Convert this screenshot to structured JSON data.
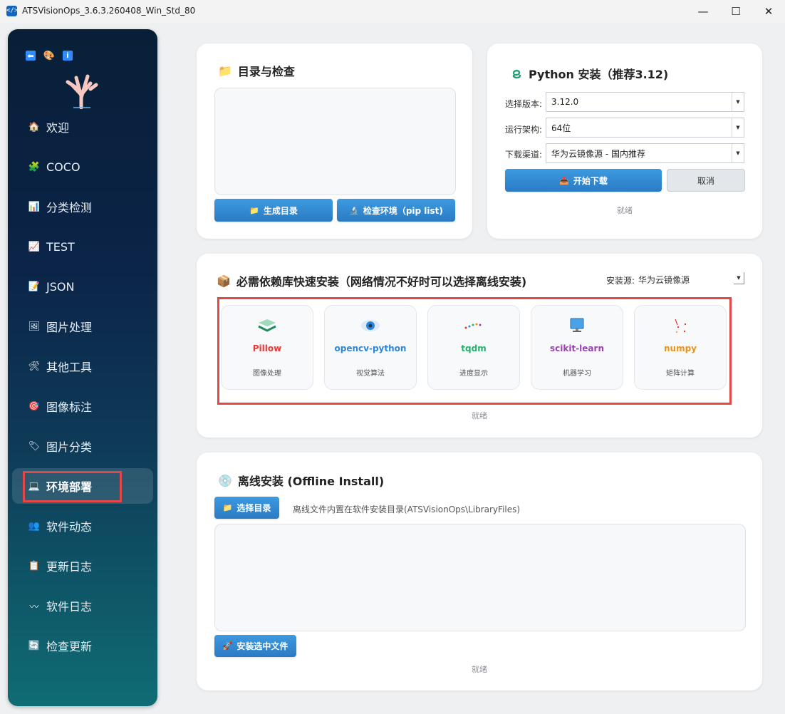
{
  "window": {
    "title": "ATSVisionOps_3.6.3.260408_Win_Std_80",
    "app_icon": "</>",
    "controls": {
      "minimize": "—",
      "maximize": "☐",
      "close": "✕"
    }
  },
  "sidebar": {
    "top_icons": [
      "back-icon",
      "palette-icon",
      "info-icon"
    ],
    "items": [
      {
        "label": "欢迎",
        "icon": "🏠",
        "icon_name": "home-icon"
      },
      {
        "label": "COCO",
        "icon": "🧩",
        "icon_name": "puzzle-icon"
      },
      {
        "label": "分类检测",
        "icon": "📊",
        "icon_name": "bar-chart-icon"
      },
      {
        "label": "TEST",
        "icon": "📈",
        "icon_name": "line-chart-icon"
      },
      {
        "label": "JSON",
        "icon": "📝",
        "icon_name": "memo-icon"
      },
      {
        "label": "图片处理",
        "icon": "🖼",
        "icon_name": "picture-icon"
      },
      {
        "label": "其他工具",
        "icon": "🛠",
        "icon_name": "tools-icon"
      },
      {
        "label": "图像标注",
        "icon": "🎯",
        "icon_name": "target-icon"
      },
      {
        "label": "图片分类",
        "icon": "🏷",
        "icon_name": "tag-icon"
      },
      {
        "label": "环境部署",
        "icon": "💻",
        "icon_name": "laptop-icon",
        "active": true
      },
      {
        "label": "软件动态",
        "icon": "👥",
        "icon_name": "people-icon"
      },
      {
        "label": "更新日志",
        "icon": "📋",
        "icon_name": "clipboard-icon"
      },
      {
        "label": "软件日志",
        "icon": "〰",
        "icon_name": "worm-icon"
      },
      {
        "label": "检查更新",
        "icon": "🔄",
        "icon_name": "refresh-icon"
      }
    ]
  },
  "directory_panel": {
    "title": "目录与检查",
    "title_icon": "📁",
    "generate_button": "生成目录",
    "check_button": "检查环境（pip list)"
  },
  "python_panel": {
    "title": "Python 安装（推荐3.12)",
    "version_label": "选择版本:",
    "version_value": "3.12.0",
    "arch_label": "运行架构:",
    "arch_value": "64位",
    "channel_label": "下载渠道:",
    "channel_value": "华为云镜像源 - 国内推荐",
    "download_button": "开始下载",
    "cancel_button": "取消",
    "status": "就绪"
  },
  "deps_panel": {
    "title": "必需依赖库快速安装（网络情况不好时可以选择离线安装)",
    "source_label": "安装源:",
    "source_value": "华为云镜像源",
    "libraries": [
      {
        "name": "Pillow",
        "desc": "图像处理",
        "color": "#e03a3a",
        "icon_name": "layers-icon"
      },
      {
        "name": "opencv-python",
        "desc": "视觉算法",
        "color": "#2f86d6",
        "icon_name": "eye-icon"
      },
      {
        "name": "tqdm",
        "desc": "进度显示",
        "color": "#22b36a",
        "icon_name": "progress-dots-icon"
      },
      {
        "name": "scikit-learn",
        "desc": "机器学习",
        "color": "#9b3fb5",
        "icon_name": "monitor-icon"
      },
      {
        "name": "numpy",
        "desc": "矩阵计算",
        "color": "#e8951c",
        "icon_name": "scatter-icon"
      }
    ],
    "status": "就绪"
  },
  "offline_panel": {
    "title": "离线安装 (Offline Install)",
    "select_button": "选择目录",
    "hint": "离线文件内置在软件安装目录(ATSVisionOps\\LibraryFiles)",
    "install_button": "安装选中文件",
    "status": "就绪"
  }
}
